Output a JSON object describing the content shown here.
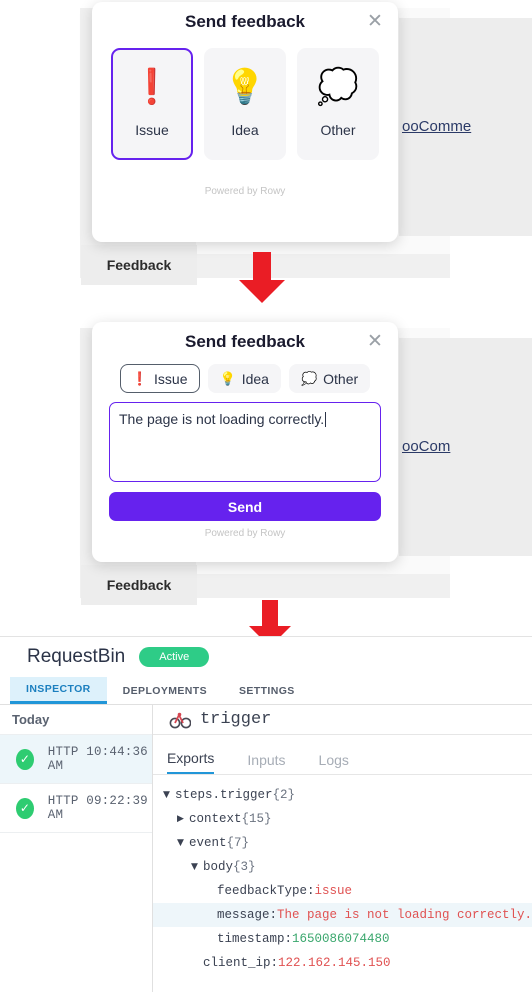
{
  "step1": {
    "background": {
      "feedback_tab_label": "Feedback",
      "partial_link_text": "ooComme"
    },
    "dialog": {
      "title": "Send feedback",
      "close_icon": "close-icon",
      "options": [
        {
          "emoji": "❗",
          "label": "Issue",
          "icon_name": "exclamation-mark-icon",
          "selected": true
        },
        {
          "emoji": "💡",
          "label": "Idea",
          "icon_name": "light-bulb-icon",
          "selected": false
        },
        {
          "emoji": "💭",
          "label": "Other",
          "icon_name": "thought-balloon-icon",
          "selected": false
        }
      ],
      "footer": "Powered by Rowy"
    }
  },
  "step2": {
    "background": {
      "feedback_tab_label": "Feedback",
      "partial_link_text": "ooCom"
    },
    "dialog": {
      "title": "Send feedback",
      "close_icon": "close-icon",
      "chips": [
        {
          "emoji": "❗",
          "label": "Issue",
          "icon_name": "exclamation-mark-icon",
          "selected": true
        },
        {
          "emoji": "💡",
          "label": "Idea",
          "icon_name": "light-bulb-icon",
          "selected": false
        },
        {
          "emoji": "💭",
          "label": "Other",
          "icon_name": "thought-balloon-icon",
          "selected": false
        }
      ],
      "message_value": "The page is not loading correctly.",
      "send_label": "Send",
      "footer": "Powered by Rowy"
    }
  },
  "arrows": {
    "color": "#ea1d25",
    "name": "down-arrow"
  },
  "requestbin": {
    "title": "RequestBin",
    "status_badge": "Active",
    "badge_color": "#2ecc87",
    "tabs": [
      {
        "label": "INSPECTOR",
        "active": true
      },
      {
        "label": "DEPLOYMENTS",
        "active": false
      },
      {
        "label": "SETTINGS",
        "active": false
      }
    ],
    "sidebar": {
      "group_label": "Today",
      "requests": [
        {
          "method": "HTTP",
          "time": "10:44:36 AM",
          "status_icon": "check-circle-icon",
          "active": true
        },
        {
          "method": "HTTP",
          "time": "09:22:39 AM",
          "status_icon": "check-circle-icon",
          "active": false
        }
      ]
    },
    "step": {
      "icon": "webhook-icon",
      "name": "trigger"
    },
    "subtabs": [
      {
        "label": "Exports",
        "active": true
      },
      {
        "label": "Inputs",
        "active": false
      },
      {
        "label": "Logs",
        "active": false
      }
    ],
    "tree": [
      {
        "indent": 0,
        "tri": "▼",
        "key": "steps.trigger",
        "meta": "{2}",
        "highlight": false
      },
      {
        "indent": 1,
        "tri": "▶",
        "key": "context",
        "meta": "{15}",
        "highlight": false
      },
      {
        "indent": 1,
        "tri": "▼",
        "key": "event",
        "meta": "{7}",
        "highlight": false
      },
      {
        "indent": 2,
        "tri": "▼",
        "key": "body",
        "meta": "{3}",
        "highlight": false
      },
      {
        "indent": 3,
        "tri": "",
        "key": "feedbackType:",
        "value": "issue",
        "vtype": "str",
        "highlight": false
      },
      {
        "indent": 3,
        "tri": "",
        "key": "message:",
        "value": "The page is not loading correctly.",
        "vtype": "str",
        "highlight": true
      },
      {
        "indent": 3,
        "tri": "",
        "key": "timestamp:",
        "value": "1650086074480",
        "vtype": "num",
        "highlight": false
      },
      {
        "indent": 2,
        "tri": "",
        "key": "client_ip:",
        "value": "122.162.145.150",
        "vtype": "str",
        "highlight": false
      }
    ]
  }
}
